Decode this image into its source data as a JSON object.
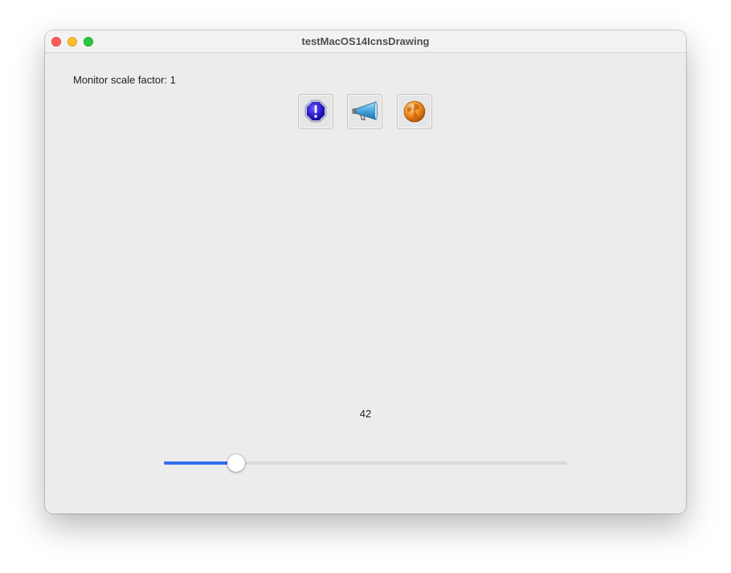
{
  "window": {
    "title": "testMacOS14IcnsDrawing"
  },
  "content": {
    "scale_label": "Monitor scale factor: 1",
    "icons": [
      {
        "name": "alert-stop-icon"
      },
      {
        "name": "megaphone-icon"
      },
      {
        "name": "globe-icon"
      }
    ],
    "value_label": "42",
    "slider": {
      "min": 0,
      "max": 255,
      "value": 42,
      "fill_color": "#2f6ef0"
    }
  }
}
